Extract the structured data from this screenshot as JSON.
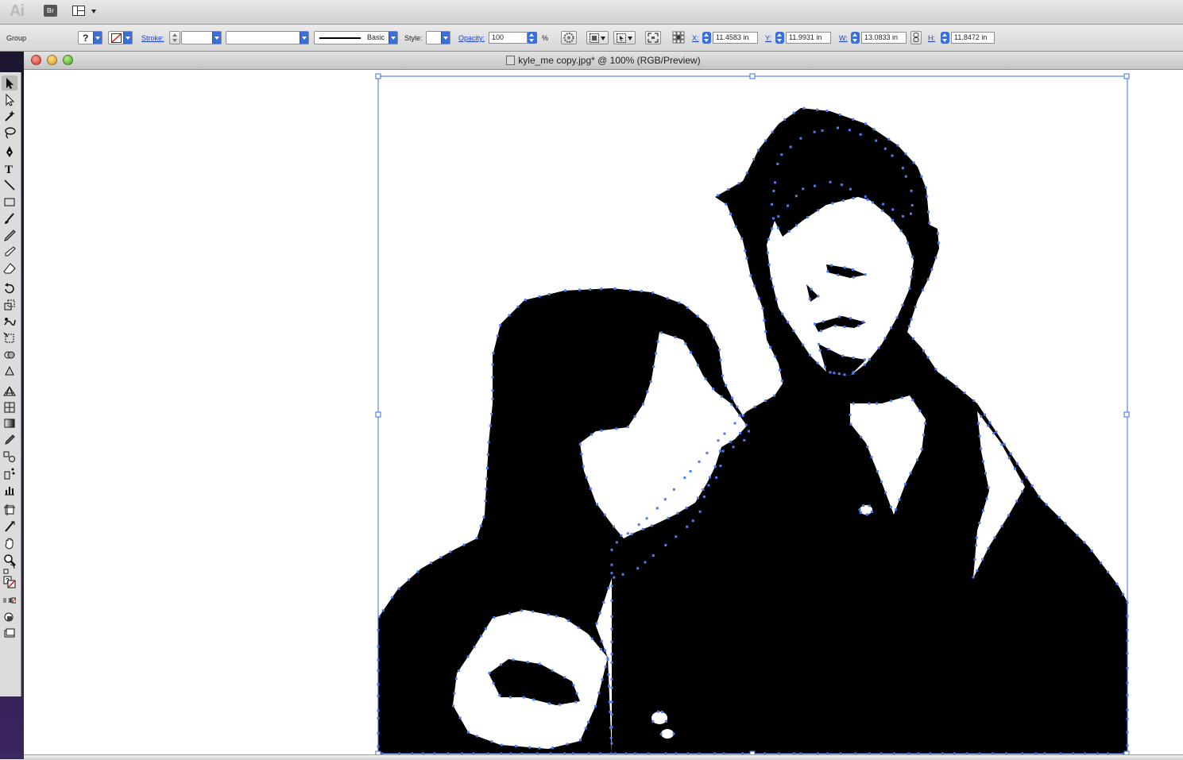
{
  "app": {
    "logo": "Ai",
    "bridge_label": "Br"
  },
  "control_bar": {
    "selection_label": "Group",
    "fill_indicator": "?",
    "stroke_label": "Stroke:",
    "stroke_value": "",
    "brush_label": "Basic",
    "style_label": "Style:",
    "opacity_label": "Opacity:",
    "opacity_value": "100",
    "percent": "%",
    "x_label": "X:",
    "x_value": "11.4583 in",
    "y_label": "Y:",
    "y_value": "11.9931 in",
    "w_label": "W:",
    "w_value": "13.0833 in",
    "h_label": "H:",
    "h_value": "11.8472 in"
  },
  "document": {
    "title": "kyle_me copy.jpg* @ 100% (RGB/Preview)"
  },
  "tools": [
    "selection-tool",
    "direct-selection-tool",
    "magic-wand-tool",
    "lasso-tool",
    "pen-tool",
    "type-tool",
    "line-segment-tool",
    "rectangle-tool",
    "paintbrush-tool",
    "pencil-tool",
    "blob-brush-tool",
    "eraser-tool",
    "rotate-tool",
    "scale-tool",
    "warp-tool",
    "free-transform-tool",
    "shape-builder-tool",
    "live-paint-tool",
    "perspective-grid-tool",
    "mesh-tool",
    "gradient-tool",
    "eyedropper-tool",
    "blend-tool",
    "symbol-sprayer-tool",
    "column-graph-tool",
    "artboard-tool",
    "slice-tool",
    "hand-tool",
    "zoom-tool"
  ],
  "colors": {
    "selection_blue": "#3b6cf0",
    "art_black": "#000000",
    "canvas_white": "#ffffff"
  }
}
